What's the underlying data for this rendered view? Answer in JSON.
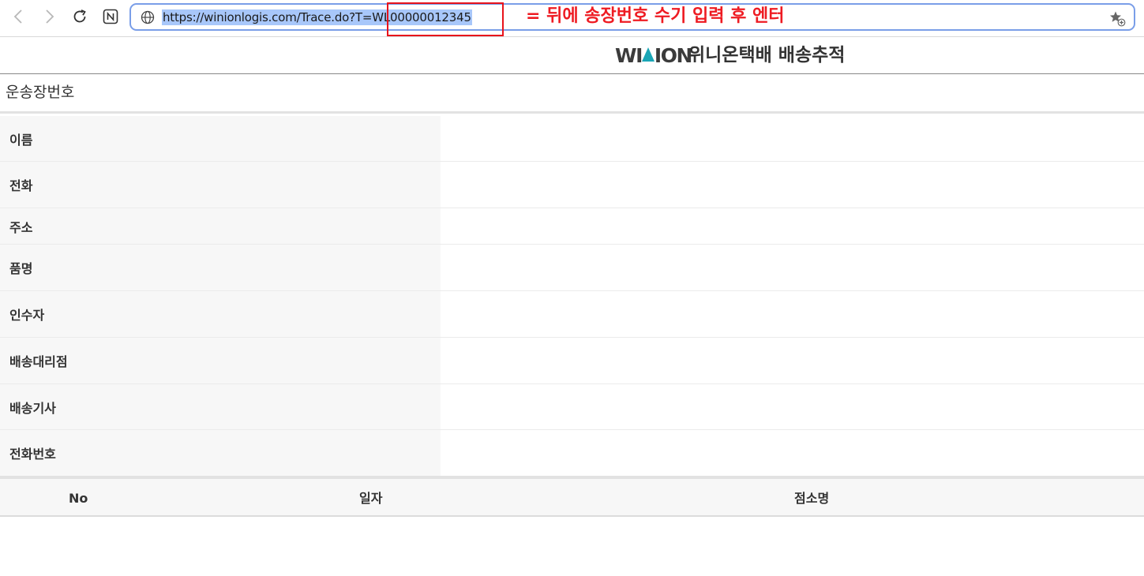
{
  "browser": {
    "url": "https://winionlogis.com/Trace.do?T=WL00000012345",
    "icons": {
      "back": "chevron-left-icon",
      "forward": "chevron-right-icon",
      "reload": "reload-icon",
      "extension": "n-extension-icon",
      "site_info": "globe-icon",
      "favorite": "star-plus-icon"
    }
  },
  "annotation": {
    "text": "= 뒤에 송장번호 수기 입력 후 엔터",
    "color": "#ee1b22"
  },
  "header": {
    "logo_text_left": "WI",
    "logo_text_right": "ION",
    "title": "위니온택배 배송추적"
  },
  "invoice": {
    "label": "운송장번호"
  },
  "details": [
    {
      "label": "이름",
      "value": ""
    },
    {
      "label": "전화",
      "value": ""
    },
    {
      "label": "주소",
      "value": ""
    },
    {
      "label": "품명",
      "value": ""
    },
    {
      "label": "인수자",
      "value": ""
    },
    {
      "label": "배송대리점",
      "value": ""
    },
    {
      "label": "배송기사",
      "value": ""
    },
    {
      "label": "전화번호",
      "value": ""
    }
  ],
  "history": {
    "columns": [
      "No",
      "일자",
      "점소명"
    ]
  },
  "colors": {
    "accent": "#7a9ee8",
    "url_selection": "#a8c7fa",
    "logo_mark": "#1aa6b6"
  }
}
